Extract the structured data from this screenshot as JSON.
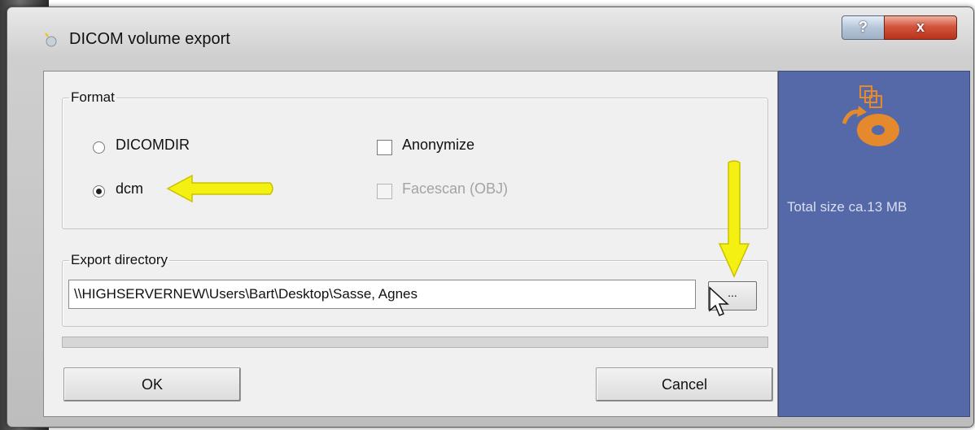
{
  "window": {
    "title": "DICOM volume export",
    "help_label": "?",
    "close_label": "x"
  },
  "format": {
    "legend": "Format",
    "options": [
      {
        "label": "DICOMDIR",
        "checked": false
      },
      {
        "label": "dcm",
        "checked": true
      }
    ],
    "checkboxes": [
      {
        "label": "Anonymize",
        "checked": false,
        "enabled": true
      },
      {
        "label": "Facescan (OBJ)",
        "checked": false,
        "enabled": false
      }
    ]
  },
  "export": {
    "legend": "Export directory",
    "path": "\\\\HIGHSERVERNEW\\Users\\Bart\\Desktop\\Sasse, Agnes",
    "browse_label": "..."
  },
  "progress": {
    "value": 0
  },
  "buttons": {
    "ok": "OK",
    "cancel": "Cancel"
  },
  "side_panel": {
    "total_size": "Total size ca.13 MB"
  },
  "colors": {
    "side_panel": "#5569a8",
    "annotation_arrow": "#f4f012",
    "close_button": "#c63f26"
  }
}
